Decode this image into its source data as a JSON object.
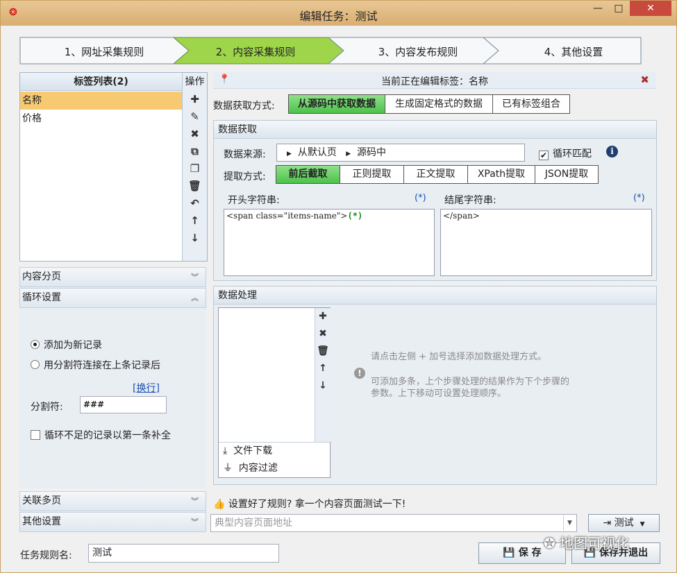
{
  "window": {
    "title": "编辑任务：测试",
    "minimize": "—",
    "maximize": "□",
    "close": "✕"
  },
  "wizard": {
    "steps": [
      "1、网址采集规则",
      "2、内容采集规则",
      "3、内容发布规则",
      "4、其他设置"
    ],
    "active": 1
  },
  "tag_panel": {
    "title": "标签列表(2)",
    "ops_title": "操作",
    "items": [
      "名称",
      "价格"
    ],
    "selected": 0
  },
  "ops_icons": [
    "plus-icon",
    "pencil-icon",
    "close-icon",
    "copy-icon",
    "paste-icon",
    "trash-icon",
    "undo-icon",
    "arrow-up-icon",
    "arrow-down-icon"
  ],
  "left_sections": {
    "content_paging": "内容分页",
    "loop_settings": "循环设置",
    "related_paging": "关联多页",
    "other_settings": "其他设置"
  },
  "loop": {
    "opt_new": "添加为新记录",
    "opt_join": "用分割符连接在上条记录后",
    "selected": "opt_new",
    "newline_link": "[换行]",
    "separator_label": "分割符:",
    "separator_value": "###",
    "fill_label": "循环不足的记录以第一条补全"
  },
  "rule_name": {
    "label": "任务规则名:",
    "value": "测试"
  },
  "edit_bar": {
    "text": "当前正在编辑标签：名称"
  },
  "mode": {
    "label": "数据获取方式:",
    "options": [
      "从源码中获取数据",
      "生成固定格式的数据",
      "已有标签组合"
    ],
    "selected": 0
  },
  "fetch": {
    "title": "数据获取",
    "source_label": "数据来源:",
    "source_parts": [
      "从默认页",
      "源码中"
    ],
    "loop_match": "循环匹配",
    "extract_label": "提取方式:",
    "extract_options": [
      "前后截取",
      "正则提取",
      "正文提取",
      "XPath提取",
      "JSON提取"
    ],
    "extract_selected": 0,
    "start_label": "开头字符串:",
    "end_label": "结尾字符串:",
    "wildcard": "(*)",
    "start_value": "<span class=\"items-name\">",
    "start_wild": "(*)",
    "end_value": "</span>"
  },
  "processing": {
    "title": "数据处理",
    "add_items": [
      "文件下载",
      "内容过滤"
    ],
    "hint1": "请点击左侧 + 加号选择添加数据处理方式。",
    "hint2": "可添加多条，上个步骤处理的结果作为下个步骤的",
    "hint3": "参数。上下移动可设置处理顺序。"
  },
  "test": {
    "hint": "设置好了规则? 拿一个内容页面测试一下!",
    "url_placeholder": "典型内容页面地址",
    "button": "测试"
  },
  "footer": {
    "save": "保 存",
    "save_exit": "保存并退出"
  },
  "watermark": "地图可视化"
}
